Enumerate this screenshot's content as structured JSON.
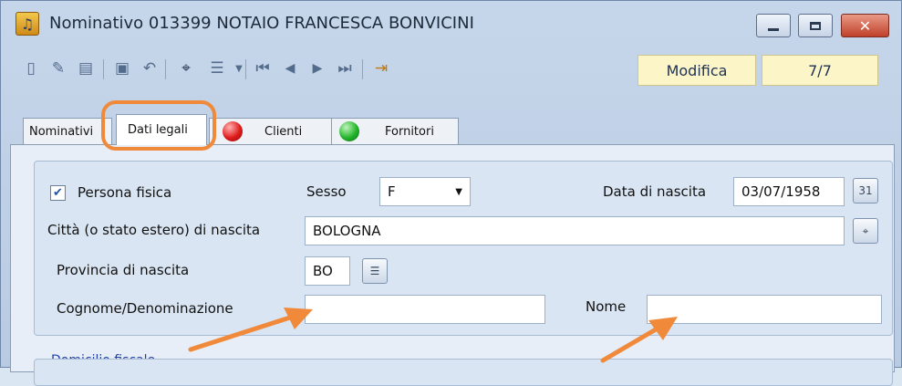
{
  "window": {
    "title": "Nominativo 013399 NOTAIO FRANCESCA BONVICINI",
    "icon": "music-note-icon"
  },
  "toolbar": {
    "icons": [
      "new-document-icon",
      "edit-document-icon",
      "document-icon",
      "save-icon",
      "undo-icon",
      "binoculars-icon",
      "list-view-icon",
      "dropdown-arrow-icon",
      "first-record-icon",
      "previous-record-icon",
      "next-record-icon",
      "last-record-icon",
      "exit-door-icon"
    ],
    "mode": "Modifica",
    "record_position": "7/7"
  },
  "tabs": [
    {
      "label": "Nominativi",
      "active": false
    },
    {
      "label": "Dati legali",
      "active": true
    },
    {
      "label": "Clienti",
      "led": "red"
    },
    {
      "label": "Fornitori",
      "led": "green"
    }
  ],
  "form": {
    "persona_fisica_label": "Persona fisica",
    "persona_fisica_checked": true,
    "sesso_label": "Sesso",
    "sesso_value": "F",
    "data_nascita_label": "Data di nascita",
    "data_nascita_value": "03/07/1958",
    "citta_label": "Città (o stato estero) di nascita",
    "citta_value": "BOLOGNA",
    "provincia_label": "Provincia di nascita",
    "provincia_value": "BO",
    "cognome_label": "Cognome/Denominazione",
    "cognome_value": "",
    "nome_label": "Nome",
    "nome_value": "",
    "domicilio_label": "Domicilio fiscale"
  },
  "colors": {
    "highlight": "#f08a3a",
    "status_bg": "#fcf5c8"
  }
}
